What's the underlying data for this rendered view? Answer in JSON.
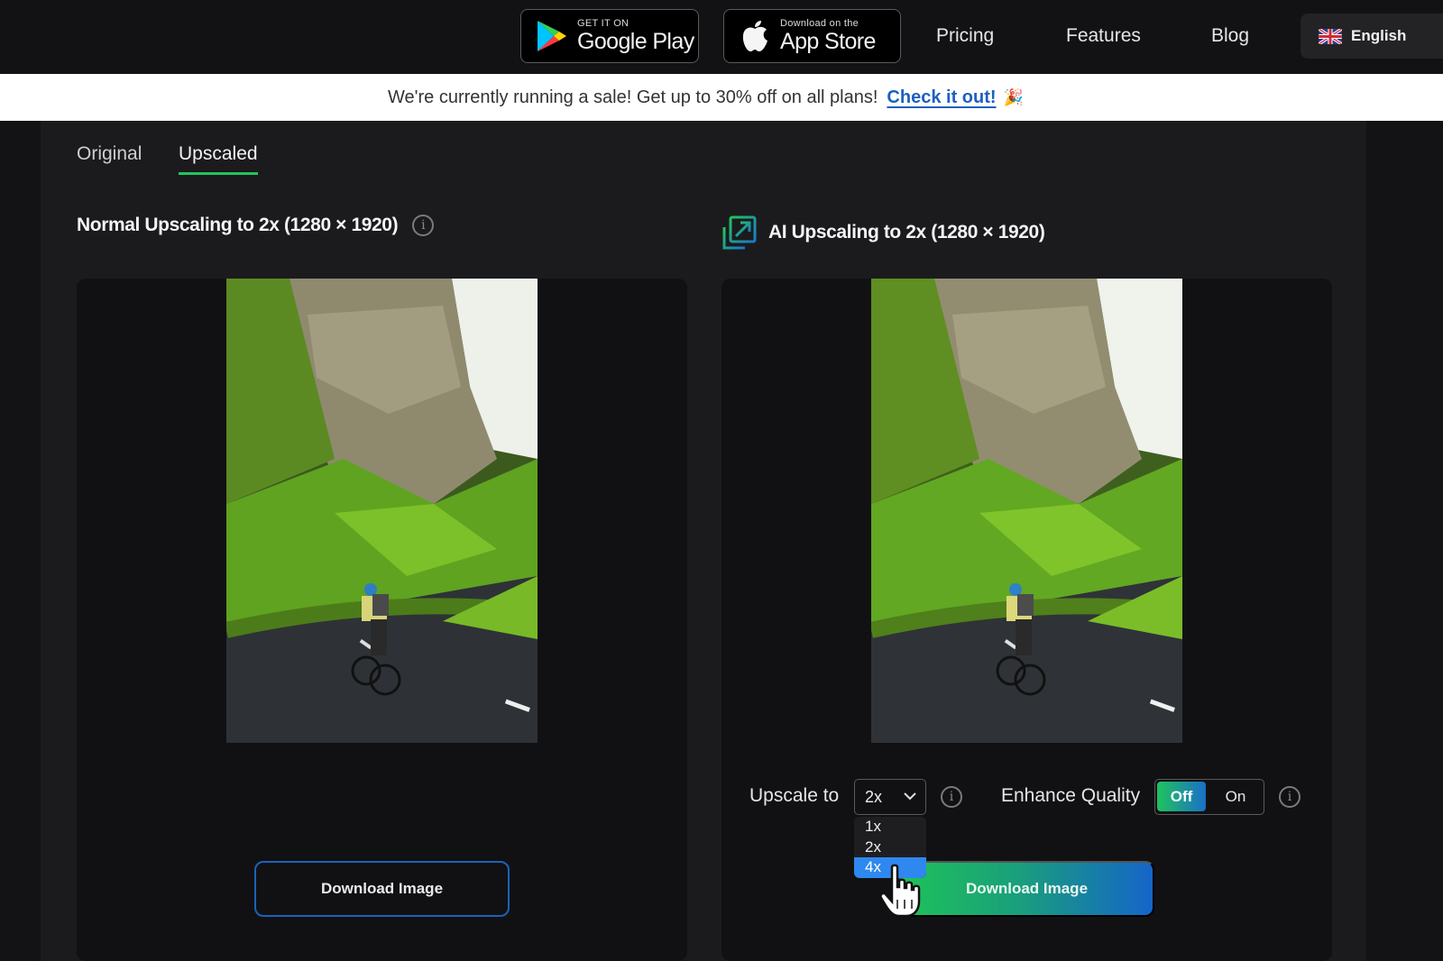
{
  "nav": {
    "google_play": {
      "small": "GET IT ON",
      "big": "Google Play"
    },
    "app_store": {
      "small": "Download on the",
      "big": "App Store"
    },
    "links": [
      {
        "label": "Pricing"
      },
      {
        "label": "Features"
      },
      {
        "label": "Blog"
      }
    ],
    "language": {
      "label": "English",
      "icon": "uk-flag-icon"
    }
  },
  "banner": {
    "text": "We're currently running a sale! Get up to 30% off on all plans!",
    "link": "Check it out!",
    "emoji": "🎉"
  },
  "tabs": [
    {
      "label": "Original",
      "active": false
    },
    {
      "label": "Upscaled",
      "active": true
    }
  ],
  "left": {
    "title": "Normal Upscaling to 2x (1280 × 1920)",
    "download_label": "Download Image"
  },
  "right": {
    "title": "AI Upscaling to 2x (1280 × 1920)",
    "upscale_label": "Upscale to",
    "upscale_value": "2x",
    "upscale_options": [
      "1x",
      "2x",
      "4x"
    ],
    "highlighted_option": "4x",
    "enhance_label": "Enhance Quality",
    "enhance_off": "Off",
    "enhance_on": "On",
    "enhance_state": "Off",
    "download_label": "Download Image"
  },
  "colors": {
    "accent_green": "#22c55e",
    "accent_blue": "#1565c8",
    "link_blue": "#1f5fbf",
    "dropdown_highlight": "#2f88f0"
  }
}
